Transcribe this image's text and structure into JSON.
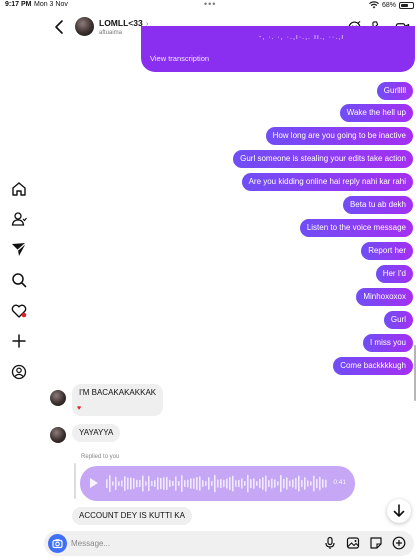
{
  "status_bar": {
    "time": "9:17 PM",
    "date": "Mon 3 Nov",
    "battery": "68%",
    "battery_level": 0.68
  },
  "header": {
    "name": "LOMLL<33",
    "chevron": "›",
    "username": "aftuaima"
  },
  "transcription_bubble": {
    "scribble": "-, ·. ·, ·.,ı·.,. ıı., ··.,ı",
    "view_transcription": "View transcription"
  },
  "outgoing_messages": [
    "Gurlllll",
    "Wake the hell up",
    "How long are you going to be inactive",
    "Gurl someone is stealing your edits take action",
    "Are you kidding online hai reply nahi kar rahi",
    "Beta tu ab dekh",
    "Listen to the voice message",
    "Report her",
    "Her I'd",
    "Minhoxoxox",
    "Gurl",
    "I miss you",
    "Come backkkkugh"
  ],
  "incoming": {
    "msg1": "I'M BACAKAKAKKAK",
    "heart": "♥",
    "msg2": "YAYAYYA",
    "replied_to": "Replied to you",
    "voice_duration": "0:41",
    "msg3": "ACCOUNT DEY IS KUTTI KA"
  },
  "composer": {
    "placeholder": "Message..."
  },
  "colors": {
    "accent_start": "#6f4ef5",
    "accent_end": "#a52ff2",
    "transcription": "#8a2ff0",
    "voice_bubble": "#c6a7f6",
    "camera": "#3f6ff5",
    "heart": "#e0202a"
  },
  "icons": [
    "back-icon",
    "video-call-icon",
    "phone-icon",
    "voice-effects-icon",
    "home-icon",
    "people-icon",
    "messages-icon",
    "search-icon",
    "notifications-icon",
    "create-icon",
    "profile-icon",
    "play-icon",
    "scroll-down-icon",
    "camera-icon",
    "microphone-icon",
    "gallery-icon",
    "sticker-icon",
    "add-icon"
  ]
}
